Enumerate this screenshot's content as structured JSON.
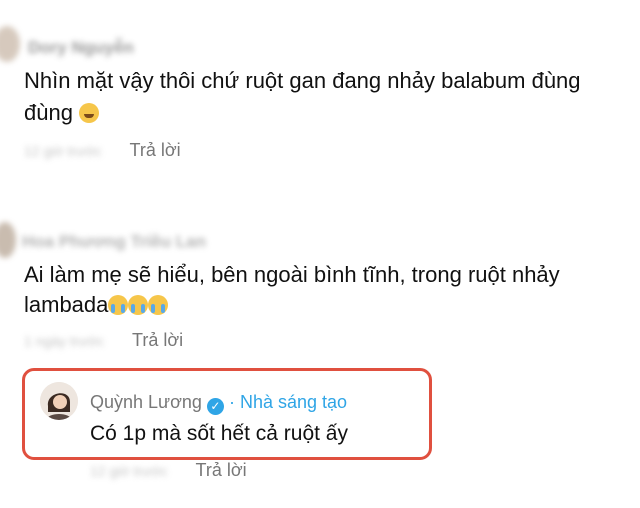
{
  "comments": [
    {
      "author": "Dory Nguyễn",
      "text_line1": "Nhìn mặt vậy thôi chứ ruột gan đang nhảy balabum đùng",
      "text_line2": "đùng",
      "emoji_icon": "grinning-sweat-emoji",
      "time": "12 giờ trước",
      "reply_label": "Trả lời"
    },
    {
      "author": "Hoa Phương Triều Lan",
      "text_line1": "Ai làm mẹ sẽ hiểu, bên ngoài bình tĩnh, trong ruột nhảy",
      "text_line2": "lambada",
      "emoji_icon": "loudly-crying-emoji",
      "time": "1 ngày trước",
      "reply_label": "Trả lời"
    }
  ],
  "reply": {
    "author": "Quỳnh Lương",
    "verified_icon": "verified-badge-icon",
    "creator_label": "Nhà sáng tạo",
    "separator": "·",
    "text": "Có 1p mà sốt hết cả ruột ấy",
    "time": "12 giờ trước",
    "reply_label": "Trả lời",
    "highlight_color": "#e0503f",
    "accent_color": "#2fa5e6"
  }
}
